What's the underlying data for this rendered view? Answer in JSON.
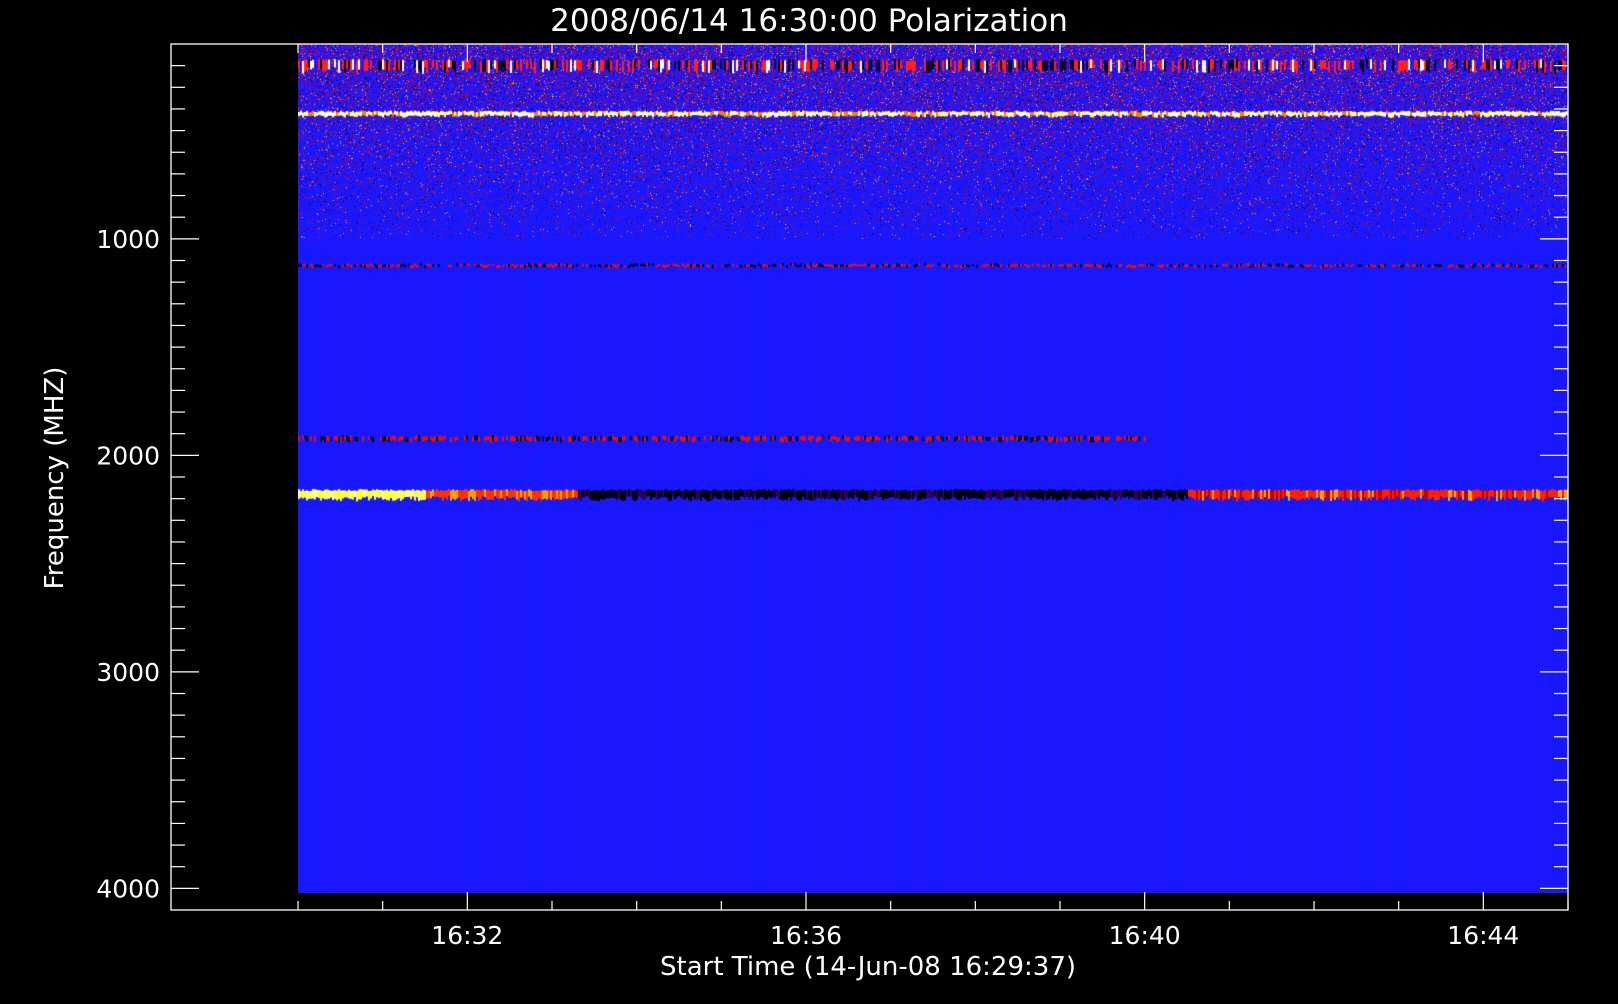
{
  "chart_data": {
    "type": "heatmap",
    "title": "2008/06/14 16:30:00 Polarization",
    "xlabel": "Start Time (14-Jun-08 16:29:37)",
    "ylabel": "Frequency (MHZ)",
    "x_ticks": [
      "16:32",
      "16:36",
      "16:40",
      "16:44"
    ],
    "x_tick_minutes": [
      2,
      6,
      10,
      14
    ],
    "x_range_minutes": [
      -1.5,
      15.0
    ],
    "x_data_range_minutes": [
      0,
      15
    ],
    "y_ticks": [
      1000,
      2000,
      3000,
      4000
    ],
    "y_range": [
      100,
      4100
    ],
    "y_data_range": [
      100,
      4020
    ],
    "y_inverted": true,
    "colormap": [
      "#000000",
      "#0000ff",
      "#ff0000",
      "#ffff00",
      "#ffffff"
    ],
    "background_value_color": "#1a1aff",
    "features": [
      {
        "freq_mhz": 200,
        "band_mhz": 60,
        "desc": "dense RFI bands (mixed)",
        "from_min": 0,
        "to_min": 15
      },
      {
        "freq_mhz": 420,
        "band_mhz": 25,
        "desc": "strong yellow-white line",
        "from_min": 0,
        "to_min": 15
      },
      {
        "freq_mhz": 1120,
        "band_mhz": 15,
        "desc": "red/black speckle line",
        "from_min": 0,
        "to_min": 15
      },
      {
        "freq_mhz": 1920,
        "band_mhz": 25,
        "desc": "red/black band",
        "from_min": 0,
        "to_min": 10
      },
      {
        "freq_mhz": 2180,
        "band_mhz": 50,
        "desc": "polarized band: yellow at start, black middle, red-orange end",
        "from_min": 0,
        "to_min": 15
      }
    ]
  }
}
